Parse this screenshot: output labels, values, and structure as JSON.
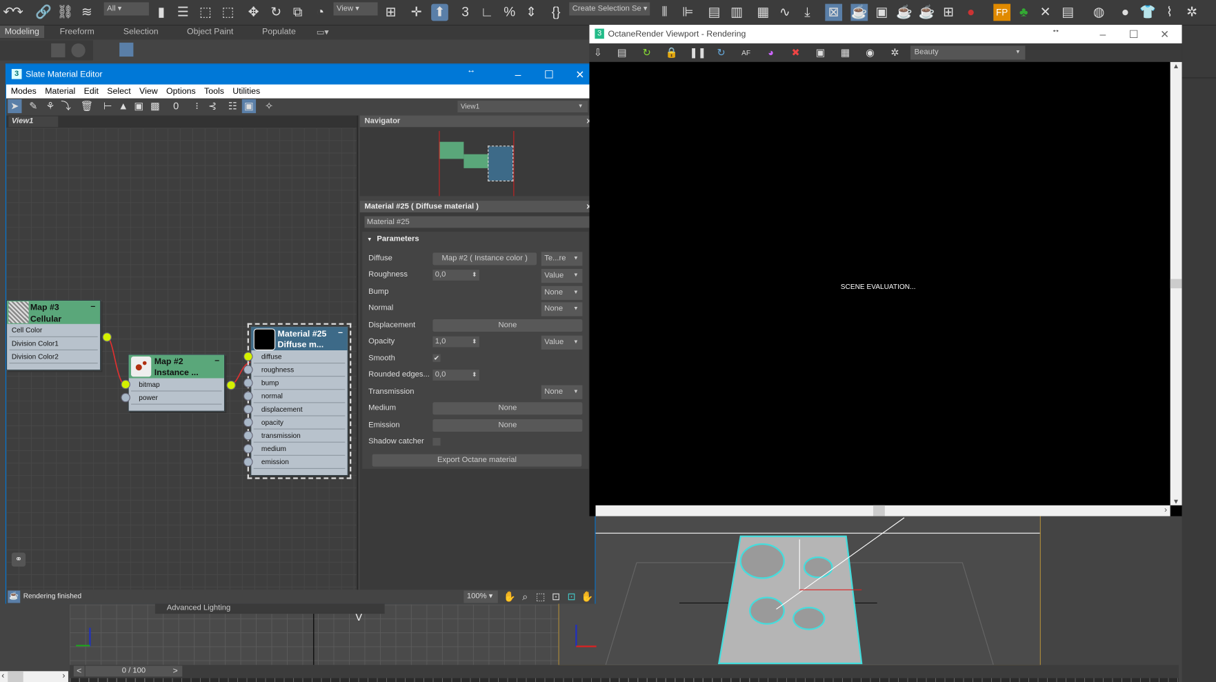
{
  "toolbar": {
    "selection_filter": "All",
    "reference_coord": "View",
    "named_selection": "Create Selection Se"
  },
  "ribbon": {
    "tabs": [
      "Modeling",
      "Freeform",
      "Selection",
      "Object Paint",
      "Populate"
    ]
  },
  "slate": {
    "title": "Slate Material Editor",
    "menu": [
      "Modes",
      "Material",
      "Edit",
      "Select",
      "View",
      "Options",
      "Tools",
      "Utilities"
    ],
    "view_dropdown": "View1",
    "view_tab": "View1",
    "status": "Rendering finished",
    "zoom": "100%",
    "nodes": {
      "cellular": {
        "title1": "Map #3",
        "title2": "Cellular",
        "rows": [
          "Cell Color",
          "Division Color1",
          "Division Color2"
        ]
      },
      "instance": {
        "title1": "Map #2",
        "title2": "Instance ...",
        "rows": [
          "bitmap",
          "power"
        ]
      },
      "material": {
        "title1": "Material #25",
        "title2": "Diffuse m...",
        "rows": [
          "diffuse",
          "roughness",
          "bump",
          "normal",
          "displacement",
          "opacity",
          "transmission",
          "medium",
          "emission"
        ]
      }
    },
    "navigator": {
      "title": "Navigator"
    },
    "params": {
      "header": "Material #25  ( Diffuse material )",
      "name_value": "Material #25",
      "section": "Parameters",
      "diffuse": {
        "label": "Diffuse",
        "map": "Map #2  ( Instance color )",
        "mode": "Te...re"
      },
      "roughness": {
        "label": "Roughness",
        "value": "0,0",
        "mode": "Value"
      },
      "bump": {
        "label": "Bump",
        "mode": "None"
      },
      "normal": {
        "label": "Normal",
        "mode": "None"
      },
      "displacement": {
        "label": "Displacement",
        "map": "None"
      },
      "opacity": {
        "label": "Opacity",
        "value": "1,0",
        "mode": "Value"
      },
      "smooth": {
        "label": "Smooth",
        "checked": true
      },
      "rounded": {
        "label": "Rounded edges...",
        "value": "0,0"
      },
      "transmission": {
        "label": "Transmission",
        "mode": "None"
      },
      "medium": {
        "label": "Medium",
        "map": "None"
      },
      "emission": {
        "label": "Emission",
        "map": "None"
      },
      "shadow": {
        "label": "Shadow catcher",
        "checked": false
      },
      "export": "Export Octane material"
    }
  },
  "octane": {
    "title": "OctaneRender Viewport - Rendering",
    "pass": "Beauty",
    "message": "SCENE EVALUATION..."
  },
  "viewport": {
    "rollout": "Advanced Lighting",
    "timeline": "0 / 100"
  },
  "colors": {
    "accent": "#0078d7",
    "node_map": "#5aa77a",
    "node_material": "#3d6a88",
    "socket_active": "#d4f000",
    "wire": "#e03030"
  }
}
